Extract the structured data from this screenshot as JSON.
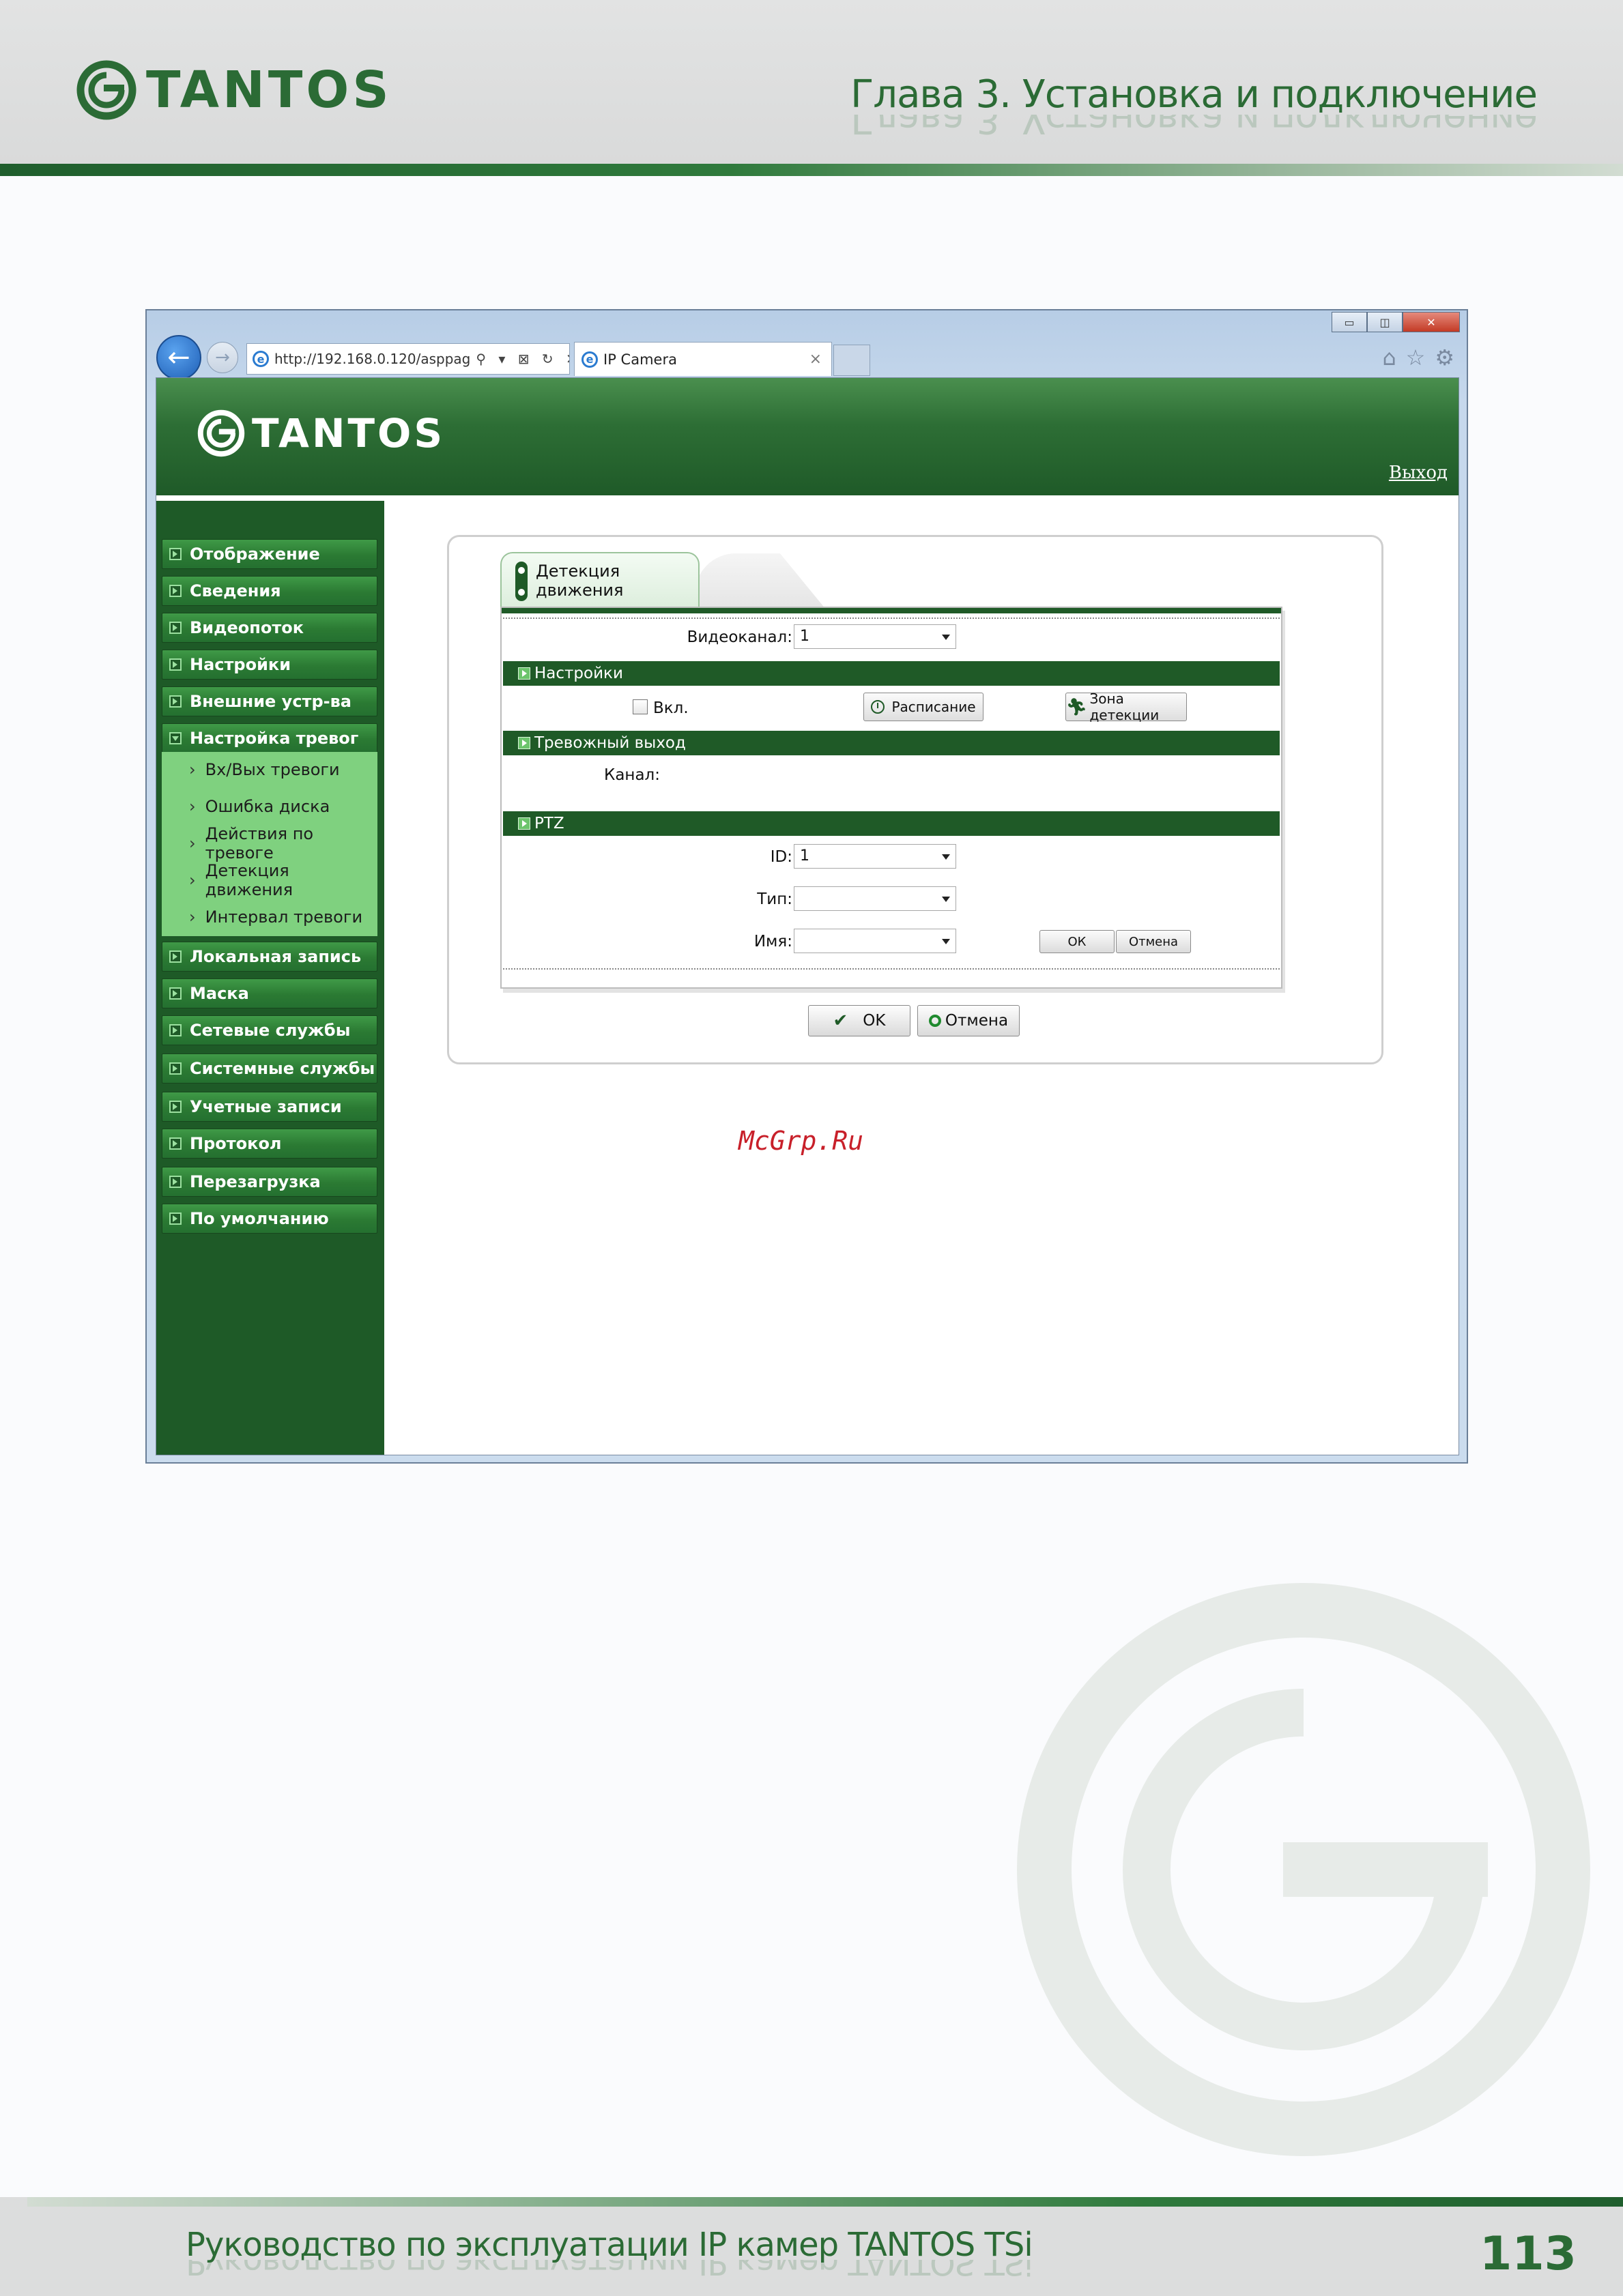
{
  "page": {
    "brand": "TANTOS",
    "chapter_title": "Глава 3. Установка и подключение",
    "footer_text": "Руководство по эксплуатации IP камер TANTOS TSi",
    "page_number": "113",
    "watermark_text": "McGrp.Ru"
  },
  "browser": {
    "address": "http://192.168.0.120/asppag",
    "address_tools": "⚲ ▾ ⊠ ↻ ✕",
    "tab_title": "IP Camera",
    "tab_close": "×",
    "controls": {
      "minimize": "▭",
      "restore": "◫",
      "close": "✕"
    },
    "right_icons": [
      "home-icon",
      "star-icon",
      "gear-icon"
    ]
  },
  "site": {
    "logo_text": "TANTOS",
    "logout": "Выход"
  },
  "sidebar": {
    "items": [
      {
        "label": "Отображение"
      },
      {
        "label": "Сведения"
      },
      {
        "label": "Видеопоток"
      },
      {
        "label": "Настройки"
      },
      {
        "label": "Внешние устр-ва"
      },
      {
        "label": "Настройка тревог",
        "open": true
      },
      {
        "label": "Локальная запись"
      },
      {
        "label": "Маска"
      },
      {
        "label": "Сетевые службы"
      },
      {
        "label": "Системные службы"
      },
      {
        "label": "Учетные записи"
      },
      {
        "label": "Протокол"
      },
      {
        "label": "Перезагрузка"
      },
      {
        "label": "По умолчанию"
      }
    ],
    "submenu": [
      {
        "label": "Вх/Вых тревоги"
      },
      {
        "label": "Ошибка диска"
      },
      {
        "label": "Действия по тревоге"
      },
      {
        "label": "Детекция движения"
      },
      {
        "label": "Интервал тревоги"
      }
    ]
  },
  "form": {
    "tab_label": "Детекция движения",
    "channel_label": "Видеоканал:",
    "channel_value": "1",
    "settings_section": "Настройки",
    "enable_label": "Вкл.",
    "schedule_button": "Расписание",
    "zone_button": "Зона детекции",
    "alarm_out_section": "Тревожный выход",
    "out_channel_label": "Канал:",
    "ptz_section": "PTZ",
    "id_label": "ID:",
    "id_value": "1",
    "type_label": "Тип:",
    "type_value": "",
    "name_label": "Имя:",
    "name_value": "",
    "ptz_ok": "ОК",
    "ptz_cancel": "Отмена",
    "ok_button": "OK",
    "cancel_button": "Отмена"
  },
  "colors": {
    "brand_green": "#2b6b35",
    "nav_dark": "#1e5a27",
    "submenu_bg": "#7fd17f",
    "watermark_red": "#c8202a"
  }
}
